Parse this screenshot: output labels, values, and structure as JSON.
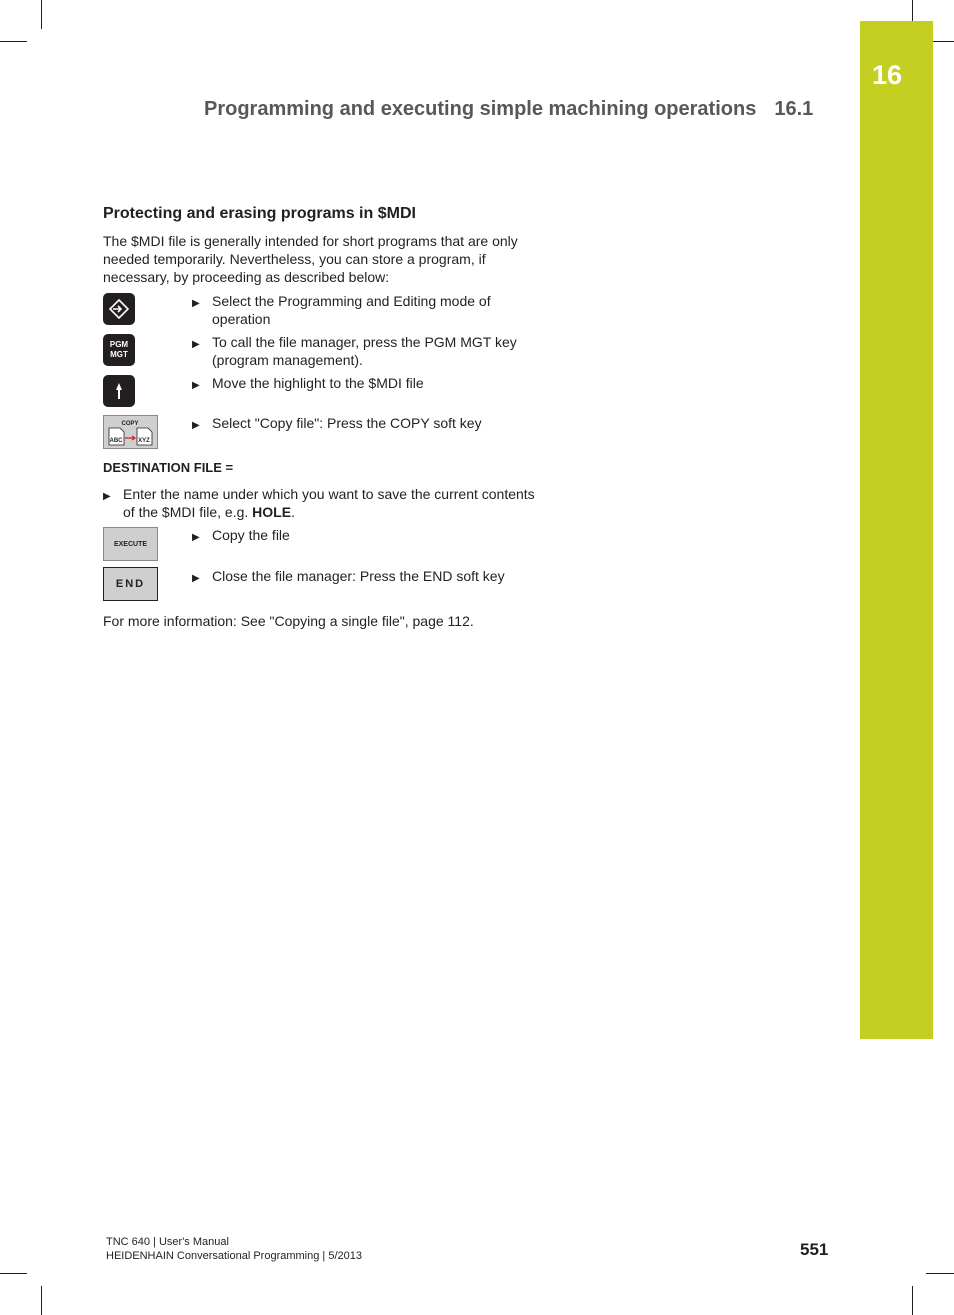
{
  "chapter_tab": {
    "number": "16",
    "color": "#c3cf21"
  },
  "running_head": {
    "title": "Programming and executing simple machining operations",
    "section": "16.1"
  },
  "section_title": "Protecting and erasing programs in $MDI",
  "intro": "The $MDI file is generally intended for short programs that are only needed temporarily. Nevertheless, you can store a program, if necessary, by proceeding as described below:",
  "steps": [
    {
      "key_icon": "programming-mode-key-icon",
      "key_label": "",
      "text": "Select the Programming and Editing mode of operation"
    },
    {
      "key_icon": "pgm-mgt-key-icon",
      "key_label": "PGM\nMGT",
      "text": "To call the file manager, press the PGM MGT key (program management)."
    },
    {
      "key_icon": "arrow-up-key-icon",
      "key_label": "",
      "text": "Move the highlight to the $MDI file"
    },
    {
      "key_icon": "copy-softkey-icon",
      "key_label": "COPY",
      "copy_from": "ABC",
      "copy_to": "XYZ",
      "text": "Select \"Copy file\": Press the COPY soft key"
    }
  ],
  "destination_label": "DESTINATION FILE =",
  "enter_step": {
    "text_before": "Enter the name under which you want to save the current contents of the $MDI file, e.g. ",
    "bold": "HOLE",
    "text_after": "."
  },
  "steps2": [
    {
      "key_label": "EXECUTE",
      "text": "Copy the file"
    },
    {
      "key_label": "END",
      "text": "Close the file manager: Press the END soft key"
    }
  ],
  "more_info": "For more information: See \"Copying a single file\", page 112.",
  "footer": {
    "line1": "TNC 640 | User's Manual",
    "line2": "HEIDENHAIN Conversational Programming | 5/2013",
    "page_number": "551"
  }
}
